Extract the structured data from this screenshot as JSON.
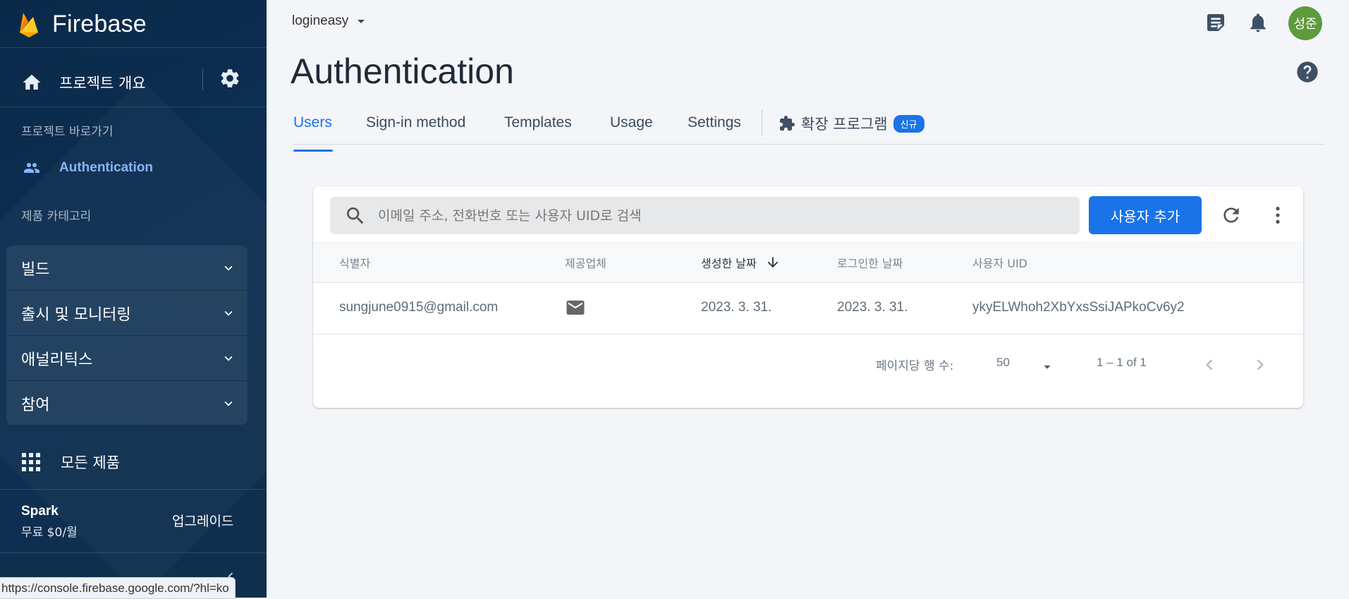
{
  "sidebar": {
    "brand": "Firebase",
    "overview_label": "프로젝트 개요",
    "shortcuts_title": "프로젝트 바로가기",
    "active_item": "Authentication",
    "categories_title": "제품 카테고리",
    "categories": [
      {
        "label": "빌드"
      },
      {
        "label": "출시 및 모니터링"
      },
      {
        "label": "애널리틱스"
      },
      {
        "label": "참여"
      }
    ],
    "all_products": "모든 제품",
    "plan_name": "Spark",
    "plan_price": "무료 $0/월",
    "upgrade_label": "업그레이드"
  },
  "status_bar_url": "https://console.firebase.google.com/?hl=ko",
  "header": {
    "project_name": "logineasy",
    "avatar_initials": "성준",
    "page_title": "Authentication"
  },
  "tabs": [
    {
      "label": "Users",
      "active": true
    },
    {
      "label": "Sign-in method"
    },
    {
      "label": "Templates"
    },
    {
      "label": "Usage"
    },
    {
      "label": "Settings"
    }
  ],
  "extensions_tab": {
    "label": "확장 프로그램",
    "badge": "신규"
  },
  "users": {
    "search_placeholder": "이메일 주소, 전화번호 또는 사용자 UID로 검색",
    "add_user_label": "사용자 추가",
    "columns": [
      "식별자",
      "제공업체",
      "생성한 날짜",
      "로그인한 날짜",
      "사용자 UID"
    ],
    "rows": [
      {
        "identifier": "sungjune0915@gmail.com",
        "provider_icon": "mail-icon",
        "created": "2023. 3. 31.",
        "signed_in": "2023. 3. 31.",
        "uid": "ykyELWhoh2XbYxsSsiJAPkoCv6y2"
      }
    ],
    "rows_per_page_label": "페이지당 행 수:",
    "rows_per_page_value": "50",
    "range_label": "1 – 1 of 1"
  },
  "colors": {
    "sidebar_bg": "#0d2f52",
    "accent": "#1a73e8",
    "active_nav": "#8ab4f8",
    "avatar": "#5e9b3d",
    "page_bg": "#f3f5f8"
  }
}
